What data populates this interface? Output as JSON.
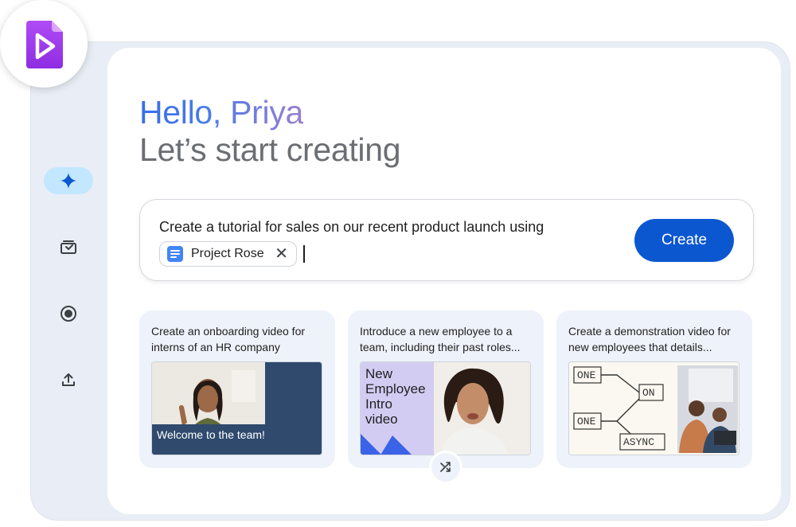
{
  "greeting": {
    "hello": "Hello, Priya",
    "subtitle": "Let’s start creating"
  },
  "rail": {
    "items": [
      {
        "icon": "sparkle-icon",
        "active": true
      },
      {
        "icon": "template-icon",
        "active": false
      },
      {
        "icon": "record-icon",
        "active": false
      },
      {
        "icon": "upload-icon",
        "active": false
      }
    ]
  },
  "prompt": {
    "text": "Create a tutorial for sales on our recent product launch using",
    "chip_label": "Project Rose",
    "create_label": "Create"
  },
  "cards": [
    {
      "text": "Create an onboarding video for interns of an HR company",
      "caption": "Welcome to the team!"
    },
    {
      "text": "Introduce a new employee to a team, including their past roles...",
      "caption": "New Employee Intro video"
    },
    {
      "text": "Create a demonstration video for new employees that details...",
      "nodes": [
        "ONE",
        "ON",
        "ONE",
        "ASYNC"
      ]
    }
  ],
  "colors": {
    "accent": "#0b57d0",
    "app_logo": "#a142f4",
    "active_rail": "#c2e7ff",
    "card_bg": "#eef2fa"
  }
}
